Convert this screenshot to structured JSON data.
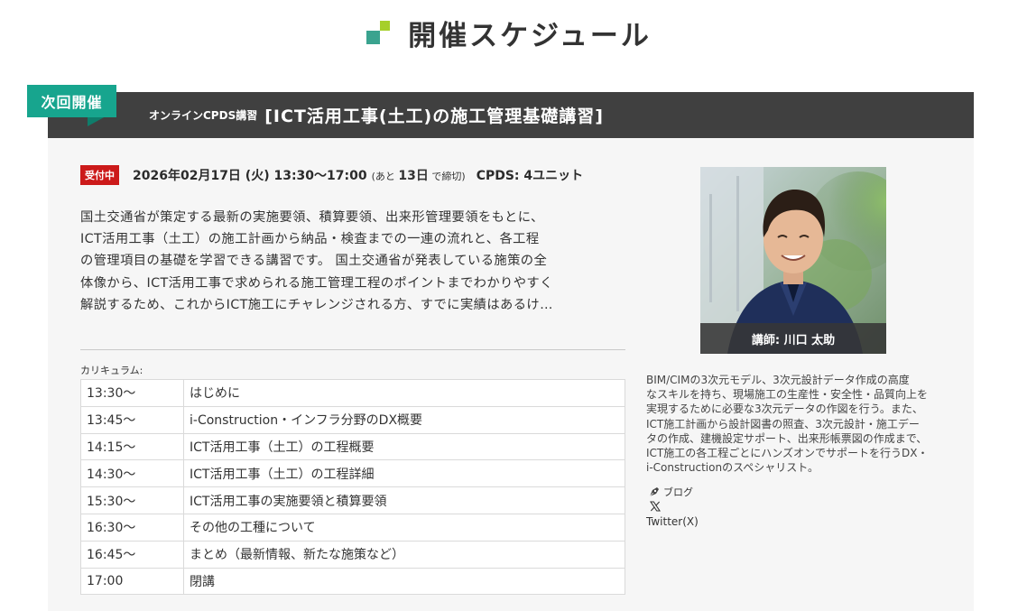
{
  "page": {
    "heading": "開催スケジュール"
  },
  "event": {
    "next_label": "次回開催",
    "kicker": "オンラインCPDS講習",
    "title": "[ICT活用工事(土工)の施工管理基礎講習]",
    "status": "受付中",
    "datetime": "2026年02月17日 (火) 13:30〜17:00",
    "deadline_prefix": "(あと",
    "deadline_days": "13日",
    "deadline_suffix": "で締切)",
    "cpds": "CPDS: 4ユニット",
    "description_lines": [
      "国土交通省が策定する最新の実施要領、積算要領、出来形管理要領をもとに、",
      "ICT活用工事（土工）の施工計画から納品・検査までの一連の流れと、各工程",
      "の管理項目の基礎を学習できる講習です。 国土交通省が発表している施策の全",
      "体像から、ICT活用工事で求められる施工管理工程のポイントまでわかりやすく",
      "解説するため、これからICT施工にチャレンジされる方、すでに実績はあるけ…"
    ],
    "curriculum_label": "カリキュラム:",
    "curriculum": [
      {
        "time": "13:30〜",
        "item": "はじめに"
      },
      {
        "time": "13:45〜",
        "item": "i-Construction・インフラ分野のDX概要"
      },
      {
        "time": "14:15〜",
        "item": "ICT活用工事（土工）の工程概要"
      },
      {
        "time": "14:30〜",
        "item": "ICT活用工事（土工）の工程詳細"
      },
      {
        "time": "15:30〜",
        "item": "ICT活用工事の実施要領と積算要領"
      },
      {
        "time": "16:30〜",
        "item": "その他の工種について"
      },
      {
        "time": "16:45〜",
        "item": "まとめ（最新情報、新たな施策など）"
      },
      {
        "time": "17:00",
        "item": "閉講"
      }
    ]
  },
  "instructor": {
    "caption": "講師: 川口 太助",
    "bio_lines": [
      "BIM/CIMの3次元モデル、3次元設計データ作成の高度",
      "なスキルを持ち、現場施工の生産性・安全性・品質向上を",
      "実現するために必要な3次元データの作図を行う。また、",
      "ICT施工計画から設計図書の照査、3次元設計・施工デー",
      "タの作成、建機設定サポート、出来形帳票図の作成まで、",
      "ICT施工の各工程ごとにハンズオンでサポートを行うDX・",
      "i-Constructionのスペシャリスト。"
    ],
    "blog_label": "ブログ",
    "twitter_label": "Twitter(X)"
  },
  "colors": {
    "accent_teal": "#17a58e",
    "accent_green": "#a6cf2a",
    "header_bar": "#404040",
    "status_red": "#cc1a1a"
  },
  "icons": {
    "blog": "pen-nib-icon",
    "twitter": "x-logo-icon"
  }
}
